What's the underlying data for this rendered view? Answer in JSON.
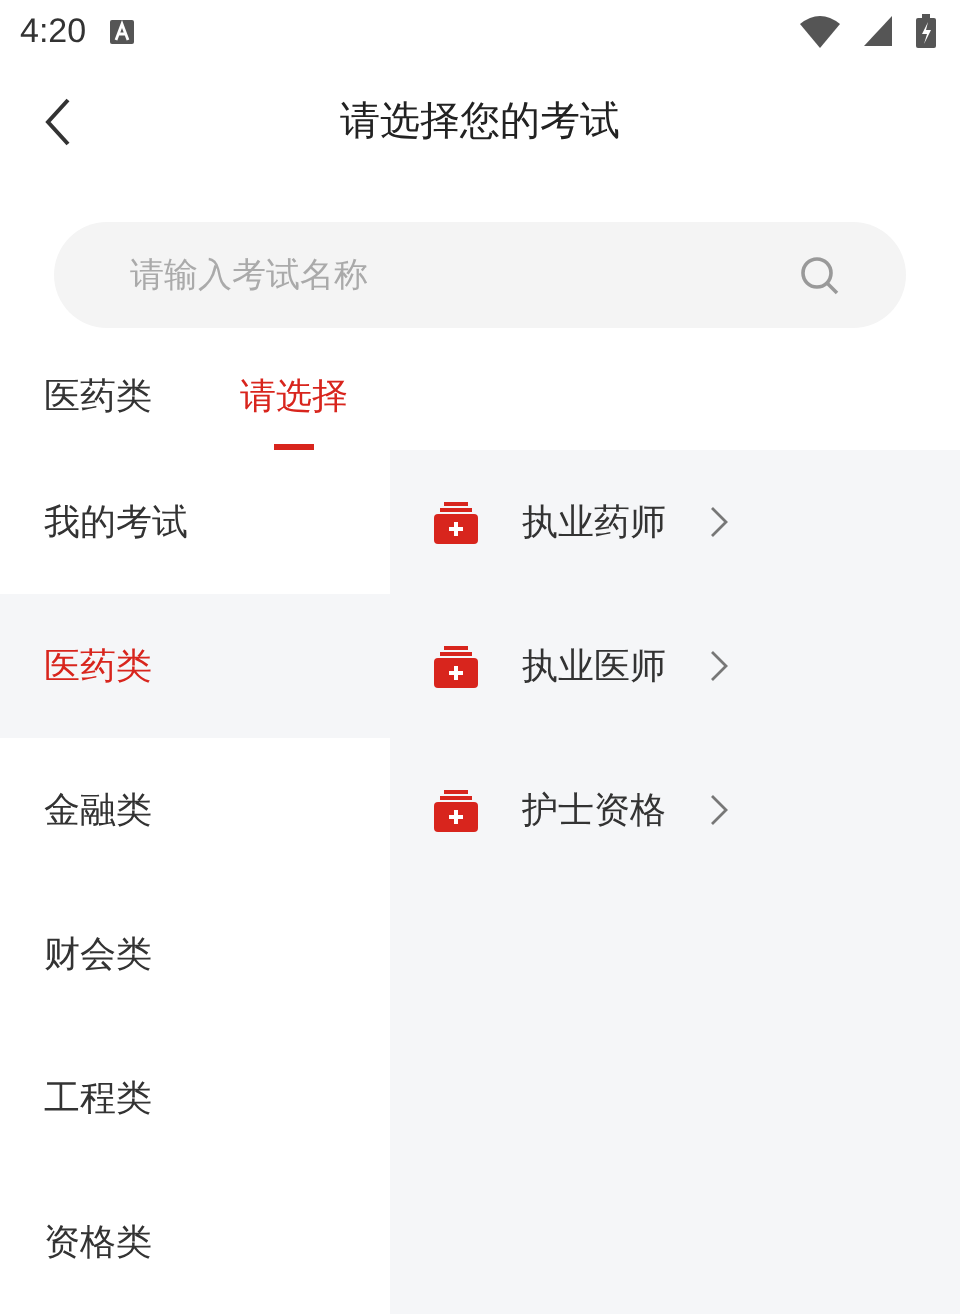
{
  "status_bar": {
    "time": "4:20"
  },
  "header": {
    "title": "请选择您的考试"
  },
  "search": {
    "placeholder": "请输入考试名称"
  },
  "tabs": [
    {
      "label": "医药类",
      "selected": false
    },
    {
      "label": "请选择",
      "selected": true
    }
  ],
  "categories": [
    {
      "label": "我的考试",
      "selected": false
    },
    {
      "label": "医药类",
      "selected": true
    },
    {
      "label": "金融类",
      "selected": false
    },
    {
      "label": "财会类",
      "selected": false
    },
    {
      "label": "工程类",
      "selected": false
    },
    {
      "label": "资格类",
      "selected": false
    }
  ],
  "exams": [
    {
      "label": "执业药师"
    },
    {
      "label": "执业医师"
    },
    {
      "label": "护士资格"
    }
  ]
}
